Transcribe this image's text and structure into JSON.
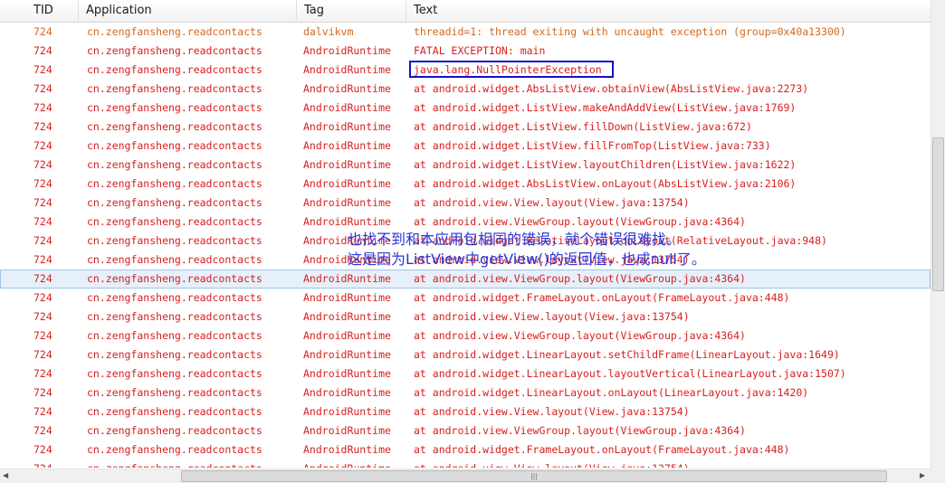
{
  "columns": {
    "tid": "TID",
    "application": "Application",
    "tag": "Tag",
    "text": "Text"
  },
  "colors": {
    "warn": "#d2691e",
    "error": "#d81e1e",
    "annotation": "#2a36d8",
    "highlight": "#1010cc"
  },
  "rows": [
    {
      "tid": "724",
      "app": "cn.zengfansheng.readcontacts",
      "tag": "dalvikvm",
      "text": "threadid=1: thread exiting with uncaught exception (group=0x40a13300)",
      "level": "warn"
    },
    {
      "tid": "724",
      "app": "cn.zengfansheng.readcontacts",
      "tag": "AndroidRuntime",
      "text": "FATAL EXCEPTION: main",
      "level": "err"
    },
    {
      "tid": "724",
      "app": "cn.zengfansheng.readcontacts",
      "tag": "AndroidRuntime",
      "text": "java.lang.NullPointerException",
      "level": "err"
    },
    {
      "tid": "724",
      "app": "cn.zengfansheng.readcontacts",
      "tag": "AndroidRuntime",
      "text": "at android.widget.AbsListView.obtainView(AbsListView.java:2273)",
      "level": "err"
    },
    {
      "tid": "724",
      "app": "cn.zengfansheng.readcontacts",
      "tag": "AndroidRuntime",
      "text": "at android.widget.ListView.makeAndAddView(ListView.java:1769)",
      "level": "err"
    },
    {
      "tid": "724",
      "app": "cn.zengfansheng.readcontacts",
      "tag": "AndroidRuntime",
      "text": "at android.widget.ListView.fillDown(ListView.java:672)",
      "level": "err"
    },
    {
      "tid": "724",
      "app": "cn.zengfansheng.readcontacts",
      "tag": "AndroidRuntime",
      "text": "at android.widget.ListView.fillFromTop(ListView.java:733)",
      "level": "err"
    },
    {
      "tid": "724",
      "app": "cn.zengfansheng.readcontacts",
      "tag": "AndroidRuntime",
      "text": "at android.widget.ListView.layoutChildren(ListView.java:1622)",
      "level": "err"
    },
    {
      "tid": "724",
      "app": "cn.zengfansheng.readcontacts",
      "tag": "AndroidRuntime",
      "text": "at android.widget.AbsListView.onLayout(AbsListView.java:2106)",
      "level": "err"
    },
    {
      "tid": "724",
      "app": "cn.zengfansheng.readcontacts",
      "tag": "AndroidRuntime",
      "text": "at android.view.View.layout(View.java:13754)",
      "level": "err"
    },
    {
      "tid": "724",
      "app": "cn.zengfansheng.readcontacts",
      "tag": "AndroidRuntime",
      "text": "at android.view.ViewGroup.layout(ViewGroup.java:4364)",
      "level": "err"
    },
    {
      "tid": "724",
      "app": "cn.zengfansheng.readcontacts",
      "tag": "AndroidRuntime",
      "text": "at android.widget.RelativeLayout.onLayout(RelativeLayout.java:948)",
      "level": "err"
    },
    {
      "tid": "724",
      "app": "cn.zengfansheng.readcontacts",
      "tag": "AndroidRuntime",
      "text": "at android.view.View.layout(View.java:13754)",
      "level": "err"
    },
    {
      "tid": "724",
      "app": "cn.zengfansheng.readcontacts",
      "tag": "AndroidRuntime",
      "text": "at android.view.ViewGroup.layout(ViewGroup.java:4364)",
      "level": "err"
    },
    {
      "tid": "724",
      "app": "cn.zengfansheng.readcontacts",
      "tag": "AndroidRuntime",
      "text": "at android.widget.FrameLayout.onLayout(FrameLayout.java:448)",
      "level": "err"
    },
    {
      "tid": "724",
      "app": "cn.zengfansheng.readcontacts",
      "tag": "AndroidRuntime",
      "text": "at android.view.View.layout(View.java:13754)",
      "level": "err"
    },
    {
      "tid": "724",
      "app": "cn.zengfansheng.readcontacts",
      "tag": "AndroidRuntime",
      "text": "at android.view.ViewGroup.layout(ViewGroup.java:4364)",
      "level": "err"
    },
    {
      "tid": "724",
      "app": "cn.zengfansheng.readcontacts",
      "tag": "AndroidRuntime",
      "text": "at android.widget.LinearLayout.setChildFrame(LinearLayout.java:1649)",
      "level": "err"
    },
    {
      "tid": "724",
      "app": "cn.zengfansheng.readcontacts",
      "tag": "AndroidRuntime",
      "text": "at android.widget.LinearLayout.layoutVertical(LinearLayout.java:1507)",
      "level": "err"
    },
    {
      "tid": "724",
      "app": "cn.zengfansheng.readcontacts",
      "tag": "AndroidRuntime",
      "text": "at android.widget.LinearLayout.onLayout(LinearLayout.java:1420)",
      "level": "err"
    },
    {
      "tid": "724",
      "app": "cn.zengfansheng.readcontacts",
      "tag": "AndroidRuntime",
      "text": "at android.view.View.layout(View.java:13754)",
      "level": "err"
    },
    {
      "tid": "724",
      "app": "cn.zengfansheng.readcontacts",
      "tag": "AndroidRuntime",
      "text": "at android.view.ViewGroup.layout(ViewGroup.java:4364)",
      "level": "err"
    },
    {
      "tid": "724",
      "app": "cn.zengfansheng.readcontacts",
      "tag": "AndroidRuntime",
      "text": "at android.widget.FrameLayout.onLayout(FrameLayout.java:448)",
      "level": "err"
    },
    {
      "tid": "724",
      "app": "cn.zengfansheng.readcontacts",
      "tag": "AndroidRuntime",
      "text": "at android.view.View.layout(View.java:13754)",
      "level": "err"
    }
  ],
  "selected_row": 13,
  "annotation": {
    "line1": "也找不到和本应用包相同的错误，就个错误很难找。",
    "line2": "这是因为ListView中getView()的返回值，也成null了。"
  },
  "scroll": {
    "hthumb_grip": "|||"
  }
}
